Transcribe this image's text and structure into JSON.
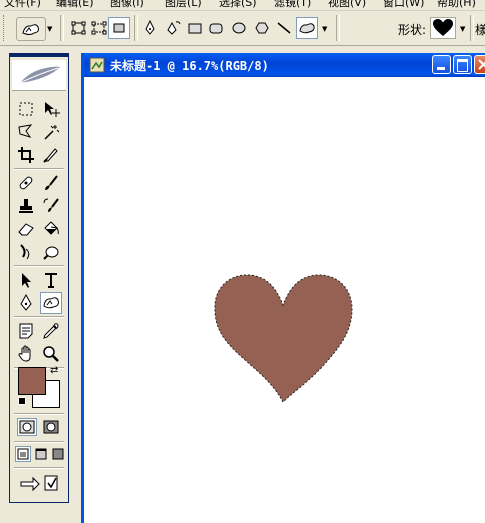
{
  "menu": {
    "items": [
      "文件(F)",
      "编辑(E)",
      "图像(I)",
      "图层(L)",
      "选择(S)",
      "滤镜(T)",
      "视图(V)",
      "窗口(W)",
      "帮助(H)"
    ]
  },
  "options_bar": {
    "shape_label": "形状:",
    "cut_label": "樣"
  },
  "document": {
    "title": "未标题-1 @ 16.7%(RGB/8)"
  },
  "colors": {
    "foreground": "#946153",
    "background": "#ffffff",
    "titlebar": "#0055e5",
    "heart_fill": "#946153"
  },
  "icons": [
    "feather-logo-icon",
    "marquee-icon",
    "move-icon",
    "lasso-icon",
    "magic-wand-icon",
    "crop-icon",
    "slice-icon",
    "healing-brush-icon",
    "brush-icon",
    "stamp-icon",
    "history-brush-icon",
    "eraser-icon",
    "paint-bucket-icon",
    "blur-icon",
    "dodge-icon",
    "path-select-icon",
    "type-icon",
    "pen-icon",
    "custom-shape-icon",
    "notes-icon",
    "eyedropper-icon",
    "hand-icon",
    "zoom-icon"
  ]
}
